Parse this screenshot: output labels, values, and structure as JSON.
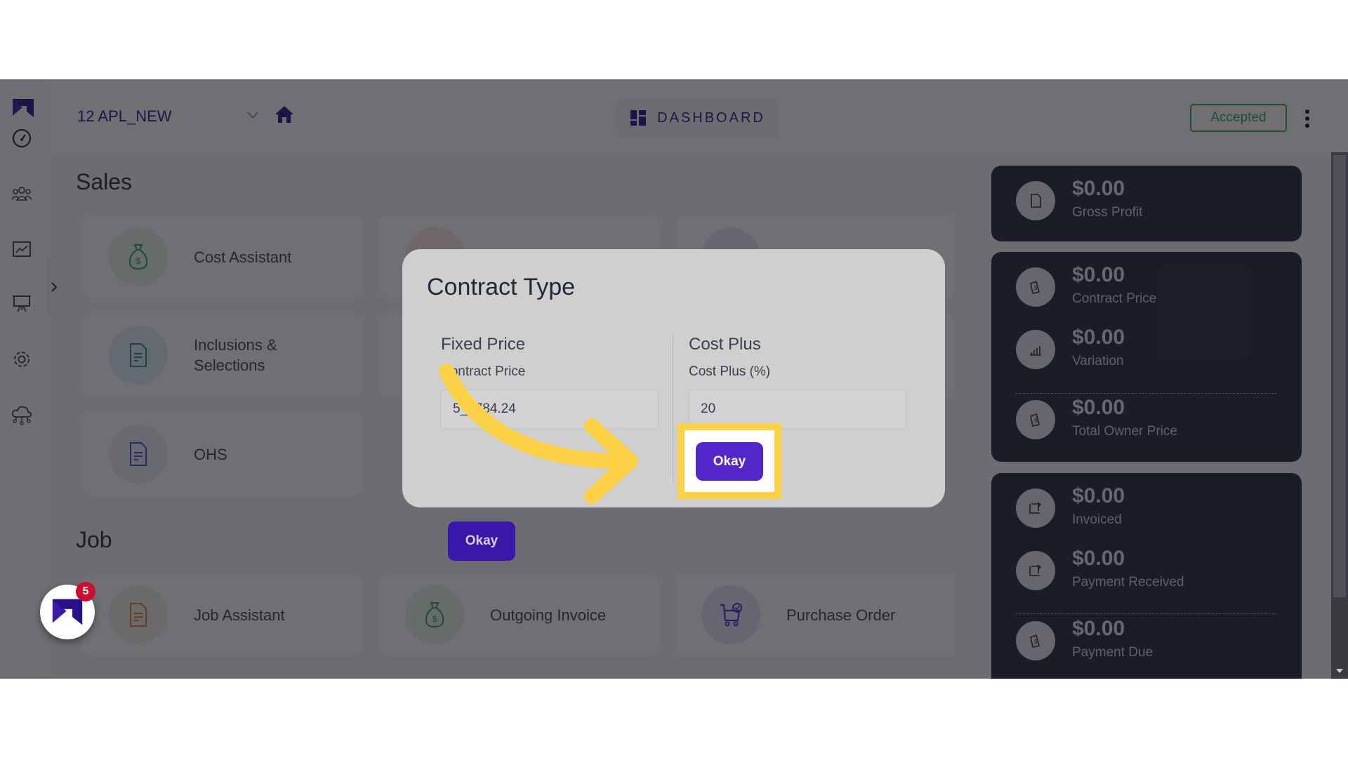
{
  "header": {
    "project": "12 APL_NEW",
    "dashboard_label": "DASHBOARD",
    "status": "Accepted"
  },
  "sidebar": {
    "icons": [
      "speedometer-icon",
      "users-icon",
      "chart-icon",
      "presentation-icon",
      "gear-icon",
      "cloud-network-icon"
    ]
  },
  "sections": {
    "sales": {
      "title": "Sales",
      "cards": [
        {
          "label": "Cost Assistant",
          "icon": "money-bag-icon",
          "color": "#2f9e44"
        },
        {
          "label": "Inclusions & Selections",
          "icon": "document-icon",
          "color": "#1c8a99"
        },
        {
          "label": "OHS",
          "icon": "document-icon",
          "color": "#3450c8"
        }
      ]
    },
    "job": {
      "title": "Job",
      "cards": [
        {
          "label": "Job Assistant",
          "icon": "document-icon",
          "color": "#e07b2a"
        },
        {
          "label": "Outgoing Invoice",
          "icon": "money-bag-icon",
          "color": "#2f9e44"
        },
        {
          "label": "Purchase Order",
          "icon": "cart-icon",
          "color": "#4a28c9"
        }
      ]
    }
  },
  "metrics": {
    "gross_profit": {
      "value": "$0.00",
      "label": "Gross Profit"
    },
    "contract_price": {
      "value": "$0.00",
      "label": "Contract Price"
    },
    "variation": {
      "value": "$0.00",
      "label": "Variation"
    },
    "total_owner_price": {
      "value": "$0.00",
      "label": "Total Owner Price"
    },
    "invoiced": {
      "value": "$0.00",
      "label": "Invoiced"
    },
    "payment_received": {
      "value": "$0.00",
      "label": "Payment Received"
    },
    "payment_due": {
      "value": "$0.00",
      "label": "Payment Due"
    }
  },
  "chat": {
    "badge_count": "5"
  },
  "modal": {
    "title": "Contract Type",
    "fixed_price": {
      "title": "Fixed Price",
      "field_label": "Contract Price",
      "value": "5_2784.24",
      "button": "Okay"
    },
    "cost_plus": {
      "title": "Cost Plus",
      "field_label": "Cost Plus (%)",
      "value": "20",
      "button": "Okay"
    }
  },
  "annotation": {
    "highlight_color": "#fcd145",
    "target": "cost-plus-okay-button"
  },
  "colors": {
    "brand": "#2a0f8a",
    "primary_button": "#5226c9",
    "accepted": "#2aa55e",
    "panel": "#1e2538"
  }
}
